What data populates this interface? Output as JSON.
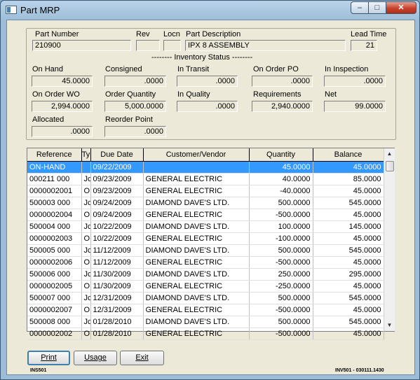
{
  "window": {
    "title": "Part MRP",
    "min": "–",
    "max": "□",
    "close": "✕"
  },
  "part": {
    "number_label": "Part Number",
    "number": "210900",
    "rev_label": "Rev",
    "rev": "",
    "locn_label": "Locn",
    "locn": "",
    "desc_label": "Part Description",
    "desc": "IPX 8 ASSEMBLY",
    "lead_label": "Lead Time",
    "lead": "21"
  },
  "inventory": {
    "title": "-------- Inventory Status --------",
    "on_hand_label": "On Hand",
    "on_hand": "45.0000",
    "consigned_label": "Consigned",
    "consigned": ".0000",
    "in_transit_label": "In Transit",
    "in_transit": ".0000",
    "on_order_po_label": "On Order PO",
    "on_order_po": ".0000",
    "in_inspection_label": "In Inspection",
    "in_inspection": ".0000",
    "on_order_wo_label": "On Order WO",
    "on_order_wo": "2,994.0000",
    "order_qty_label": "Order Quantity",
    "order_qty": "5,000.0000",
    "in_quality_label": "In Quality",
    "in_quality": ".0000",
    "requirements_label": "Requirements",
    "requirements": "2,940.0000",
    "net_label": "Net",
    "net": "99.0000",
    "allocated_label": "Allocated",
    "allocated": ".0000",
    "reorder_label": "Reorder Point",
    "reorder": ".0000"
  },
  "grid": {
    "columns": [
      "Reference",
      "Ty",
      "Due Date",
      "Customer/Vendor",
      "Quantity",
      "Balance"
    ],
    "rows": [
      [
        "ON-HAND",
        "",
        "09/22/2009",
        "",
        "45.0000",
        "45.0000"
      ],
      [
        "000211 000",
        "Jc",
        "09/23/2009",
        "GENERAL ELECTRIC",
        "40.0000",
        "85.0000"
      ],
      [
        "0000002001",
        "O",
        "09/23/2009",
        "GENERAL ELECTRIC",
        "-40.0000",
        "45.0000"
      ],
      [
        "500003 000",
        "Jc",
        "09/24/2009",
        "DIAMOND DAVE'S LTD.",
        "500.0000",
        "545.0000"
      ],
      [
        "0000002004",
        "O",
        "09/24/2009",
        "GENERAL ELECTRIC",
        "-500.0000",
        "45.0000"
      ],
      [
        "500004 000",
        "Jc",
        "10/22/2009",
        "DIAMOND DAVE'S LTD.",
        "100.0000",
        "145.0000"
      ],
      [
        "0000002003",
        "O",
        "10/22/2009",
        "GENERAL ELECTRIC",
        "-100.0000",
        "45.0000"
      ],
      [
        "500005 000",
        "Jc",
        "11/12/2009",
        "DIAMOND DAVE'S LTD.",
        "500.0000",
        "545.0000"
      ],
      [
        "0000002006",
        "O",
        "11/12/2009",
        "GENERAL ELECTRIC",
        "-500.0000",
        "45.0000"
      ],
      [
        "500006 000",
        "Jc",
        "11/30/2009",
        "DIAMOND DAVE'S LTD.",
        "250.0000",
        "295.0000"
      ],
      [
        "0000002005",
        "O",
        "11/30/2009",
        "GENERAL ELECTRIC",
        "-250.0000",
        "45.0000"
      ],
      [
        "500007 000",
        "Jc",
        "12/31/2009",
        "DIAMOND DAVE'S LTD.",
        "500.0000",
        "545.0000"
      ],
      [
        "0000002007",
        "O",
        "12/31/2009",
        "GENERAL ELECTRIC",
        "-500.0000",
        "45.0000"
      ],
      [
        "500008 000",
        "Jc",
        "01/28/2010",
        "DIAMOND DAVE'S LTD.",
        "500.0000",
        "545.0000"
      ],
      [
        "0000002002",
        "O",
        "01/28/2010",
        "GENERAL ELECTRIC",
        "-500.0000",
        "45.0000"
      ]
    ],
    "selected_row": 0
  },
  "buttons": {
    "print": "Print",
    "usage": "Usage",
    "exit": "Exit"
  },
  "footer": {
    "left": "INS501",
    "right": "INV501 - 030111.1430"
  },
  "colors": {
    "selection": "#3399ff",
    "close": "#c7432d"
  }
}
